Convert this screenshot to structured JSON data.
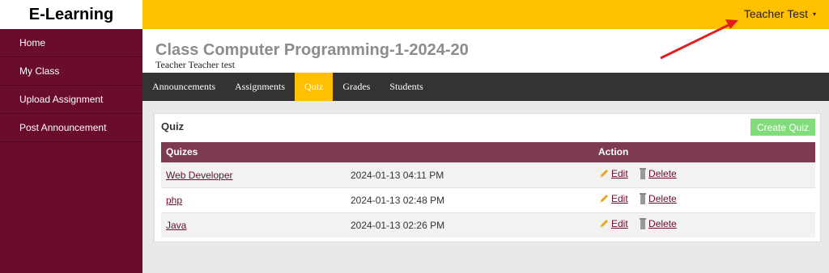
{
  "brand": {
    "name": "E-Learning"
  },
  "topbar": {
    "user_name": "Teacher Test",
    "caret": "▾"
  },
  "sidebar": {
    "items": [
      {
        "label": "Home"
      },
      {
        "label": "My Class"
      },
      {
        "label": "Upload Assignment"
      },
      {
        "label": "Post Announcement"
      }
    ]
  },
  "header": {
    "class_title": "Class Computer Programming-1-2024-20",
    "teacher_subtitle": "Teacher Teacher test"
  },
  "tabs": [
    {
      "label": "Announcements"
    },
    {
      "label": "Assignments"
    },
    {
      "label": "Quiz",
      "active": true
    },
    {
      "label": "Grades"
    },
    {
      "label": "Students"
    }
  ],
  "quiz_panel": {
    "title": "Quiz",
    "create_label": "Create Quiz",
    "columns": [
      "Quizes",
      "Action"
    ],
    "rows": [
      {
        "name": "Web Developer",
        "date": "2024-01-13 04:11 PM",
        "edit": "Edit",
        "delete": "Delete"
      },
      {
        "name": "php",
        "date": "2024-01-13 02:48 PM",
        "edit": "Edit",
        "delete": "Delete"
      },
      {
        "name": "Java",
        "date": "2024-01-13 02:26 PM",
        "edit": "Edit",
        "delete": "Delete"
      }
    ]
  },
  "colors": {
    "topbar": "#ffc000",
    "sidebar": "#6a0d2a",
    "table_header": "#7d3a50",
    "create_button": "#82dc7c",
    "annotation_arrow": "#e02020"
  }
}
